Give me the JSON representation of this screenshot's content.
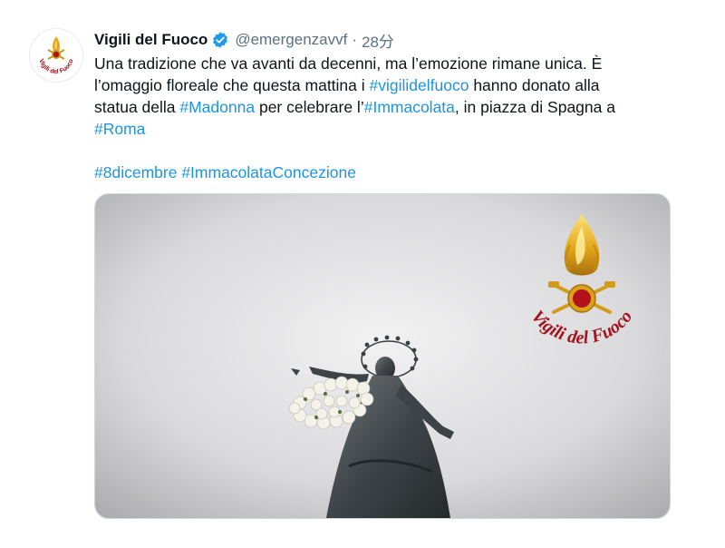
{
  "tweet": {
    "author_name": "Vigili del Fuoco",
    "handle": "@emergenzavvf",
    "separator": "·",
    "time": "28分",
    "line1": "Una tradizione che va avanti da decenni, ma l’emozione rimane unica. È",
    "line2_a": "l’omaggio floreale che questa mattina i ",
    "hashtag_vigili": "#vigilidelfuoco",
    "line2_b": " hanno donato alla",
    "line3_a": "statua della ",
    "hashtag_madonna": "#Madonna",
    "line3_b": " per celebrare l’",
    "hashtag_immacolata": "#Immacolata",
    "line3_c": ", in piazza di Spagna a",
    "hashtag_roma": "#Roma",
    "hashtag_8dicembre": "#8dicembre",
    "hashtag_concezione": "#ImmacolataConcezione"
  },
  "media": {
    "logo_text": "Vigili del Fuoco",
    "avatar_logo_text": "Vigili del Fuoco"
  },
  "colors": {
    "link": "#1b95e0",
    "verified": "#1d9bf0",
    "logo_red": "#a5121b",
    "logo_gold": "#e3a81c"
  },
  "icons": [
    "verified-badge-icon",
    "vvf-flame-logo"
  ]
}
